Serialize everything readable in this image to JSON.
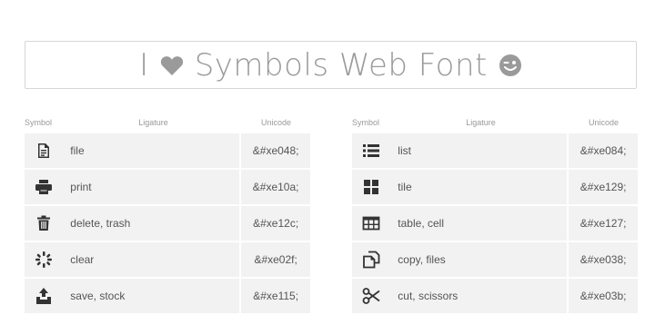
{
  "title": {
    "prefix": "I",
    "heart": "heart-icon",
    "text": "Symbols Web Font",
    "smiley": "wink-icon"
  },
  "columns": {
    "symbol": "Symbol",
    "ligature": "Ligature",
    "unicode": "Unicode"
  },
  "left_rows": [
    {
      "icon": "file-icon",
      "ligature": "file",
      "unicode": "&#xe048;"
    },
    {
      "icon": "print-icon",
      "ligature": "print",
      "unicode": "&#xe10a;"
    },
    {
      "icon": "trash-icon",
      "ligature": "delete, trash",
      "unicode": "&#xe12c;"
    },
    {
      "icon": "clear-icon",
      "ligature": "clear",
      "unicode": "&#xe02f;"
    },
    {
      "icon": "save-icon",
      "ligature": "save, stock",
      "unicode": "&#xe115;"
    }
  ],
  "right_rows": [
    {
      "icon": "list-icon",
      "ligature": "list",
      "unicode": "&#xe084;"
    },
    {
      "icon": "tile-icon",
      "ligature": "tile",
      "unicode": "&#xe129;"
    },
    {
      "icon": "table-icon",
      "ligature": "table, cell",
      "unicode": "&#xe127;"
    },
    {
      "icon": "copy-icon",
      "ligature": "copy, files",
      "unicode": "&#xe038;"
    },
    {
      "icon": "scissors-icon",
      "ligature": "cut, scissors",
      "unicode": "&#xe03b;"
    }
  ]
}
